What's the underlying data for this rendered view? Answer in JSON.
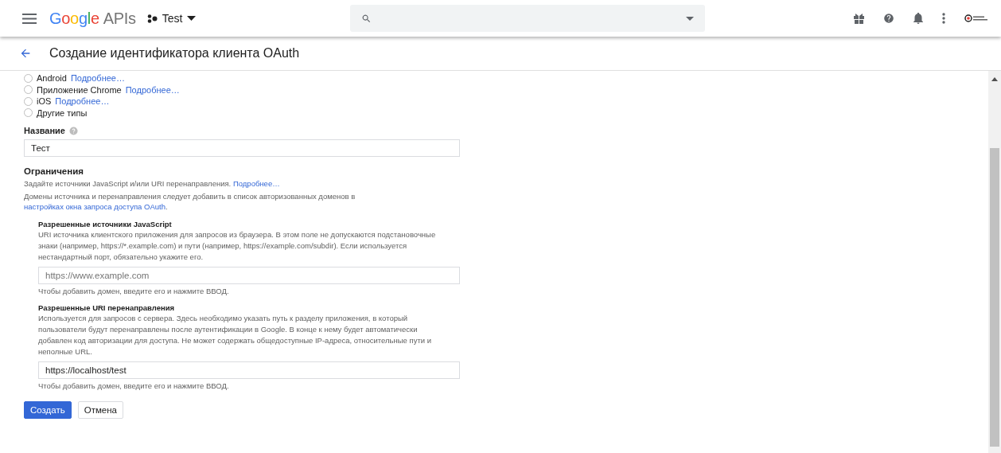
{
  "header": {
    "logo": {
      "brand": "Google",
      "product": "APIs"
    },
    "project": "Test"
  },
  "page": {
    "title": "Создание идентификатора клиента OAuth"
  },
  "app_types": [
    {
      "label": "Android",
      "link": "Подробнее…",
      "selected": false
    },
    {
      "label": "Приложение Chrome",
      "link": "Подробнее…",
      "selected": false
    },
    {
      "label": "iOS",
      "link": "Подробнее…",
      "selected": false
    },
    {
      "label": "Другие типы",
      "selected": false
    }
  ],
  "name_field": {
    "label": "Название",
    "value": "Тест"
  },
  "restrictions": {
    "title": "Ограничения",
    "intro": "Задайте источники JavaScript и/или URI перенаправления.",
    "intro_link": "Подробнее…",
    "domains_text": "Домены источника и перенаправления следует добавить в список авторизованных доменов в",
    "domains_link": "настройках окна запроса доступа OAuth",
    "domains_end": "."
  },
  "sections": [
    {
      "title": "Разрешенные источники JavaScript",
      "description": "URI источника клиентского приложения для запросов из браузера. В этом поле не допускаются подстановочные знаки (например, https://*.example.com) и пути (например, https://example.com/subdir). Если используется нестандартный порт, обязательно укажите его.",
      "placeholder": "https://www.example.com",
      "hint": "Чтобы добавить домен, введите его и нажмите ВВОД."
    },
    {
      "title": "Разрешенные URI перенаправления",
      "description": "Используется для запросов с сервера. Здесь необходимо указать путь к разделу приложения, в который пользователи будут перенаправлены после аутентификации в Google. В конце к нему будет автоматически добавлен код авторизации для доступа. Не может содержать общедоступные IP-адреса, относительные пути и неполные URL.",
      "value": "https://localhost/test",
      "hint": "Чтобы добавить домен, введите его и нажмите ВВОД."
    }
  ],
  "buttons": [
    {
      "label": "Создать",
      "kind": "primary"
    },
    {
      "label": "Отмена",
      "kind": "secondary"
    }
  ]
}
